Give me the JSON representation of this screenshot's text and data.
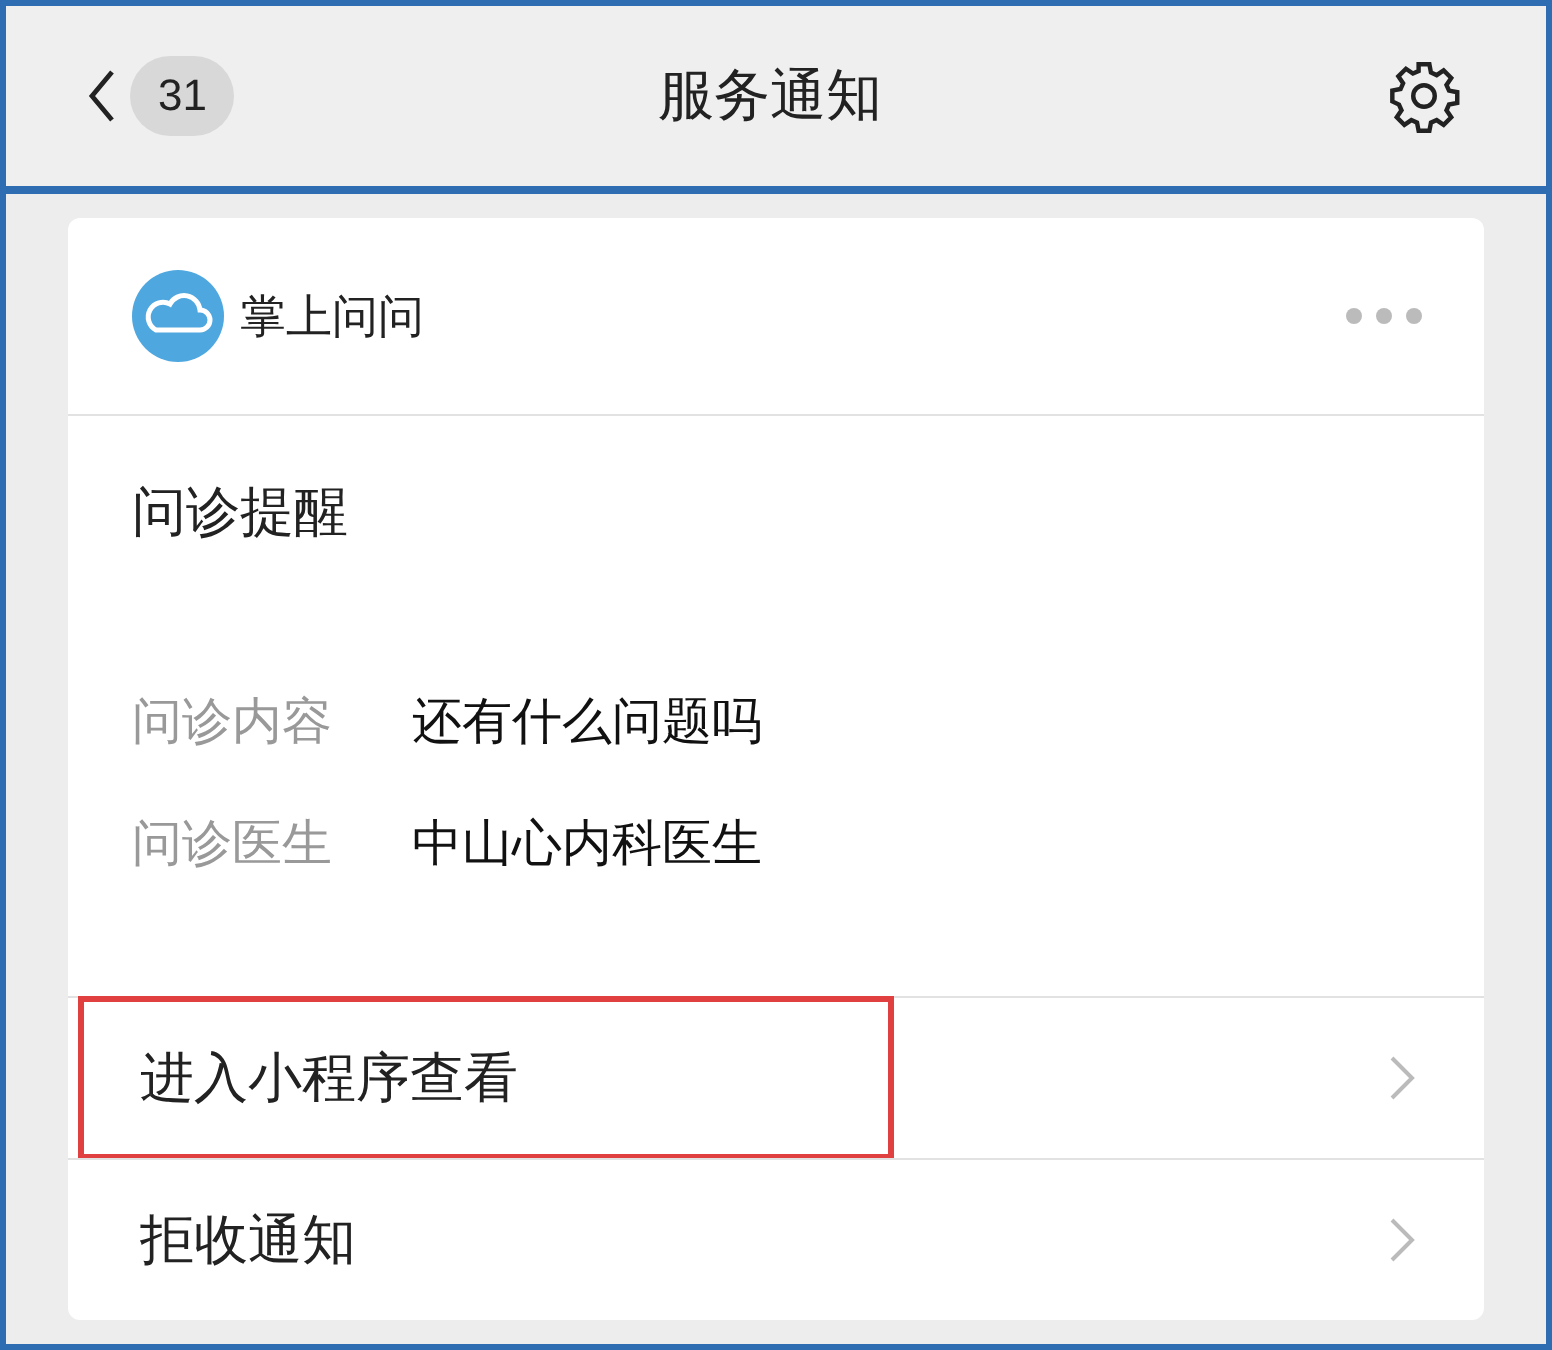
{
  "header": {
    "back_count": "31",
    "title": "服务通知"
  },
  "card": {
    "app_name": "掌上问问",
    "title": "问诊提醒",
    "fields": [
      {
        "label": "问诊内容",
        "value": "还有什么问题吗"
      },
      {
        "label": "问诊医生",
        "value": "中山心内科医生"
      }
    ],
    "actions": [
      {
        "label": "进入小程序查看",
        "highlighted": true
      },
      {
        "label": "拒收通知",
        "highlighted": false
      }
    ]
  }
}
